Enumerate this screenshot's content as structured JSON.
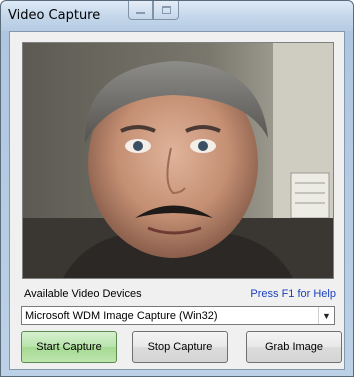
{
  "window": {
    "title": "Video Capture"
  },
  "video": {
    "icon": "webcam-preview"
  },
  "devices": {
    "label": "Available Video Devices",
    "help_hint": "Press F1 for Help",
    "selected": "Microsoft WDM Image Capture (Win32)"
  },
  "buttons": {
    "start": "Start Capture",
    "stop": "Stop Capture",
    "grab": "Grab Image"
  },
  "colors": {
    "help_link": "#1c3fbf",
    "start_button": "#b8e3ab"
  }
}
